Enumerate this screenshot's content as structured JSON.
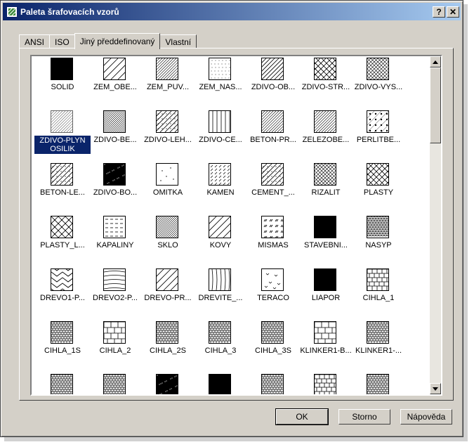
{
  "window": {
    "title": "Paleta šrafovacích vzorů",
    "help_label": "?",
    "close_label": "✕"
  },
  "tabs": [
    {
      "label": "ANSI"
    },
    {
      "label": "ISO"
    },
    {
      "label": "Jiný předdefinovaný"
    },
    {
      "label": "Vlastní"
    }
  ],
  "active_tab": "Jiný předdefinovaný",
  "patterns": [
    {
      "label": "SOLID",
      "pattern": "solid"
    },
    {
      "label": "ZEM_OBE...",
      "pattern": "diag-wide"
    },
    {
      "label": "ZEM_PUV...",
      "pattern": "diag-dense"
    },
    {
      "label": "ZEM_NAS...",
      "pattern": "dots"
    },
    {
      "label": "ZDIVO-OB...",
      "pattern": "diag-medium"
    },
    {
      "label": "ZDIVO-STR...",
      "pattern": "crosshatch"
    },
    {
      "label": "ZDIVO-VYS...",
      "pattern": "crosshatch-dense"
    },
    {
      "label": "ZDIVO-PLYN OSILIK",
      "pattern": "diag-dense",
      "selected": true
    },
    {
      "label": "ZDIVO-BE...",
      "pattern": "crosshatch-fine"
    },
    {
      "label": "ZDIVO-LEH...",
      "pattern": "diag-dots"
    },
    {
      "label": "ZDIVO-CE...",
      "pattern": "vertical"
    },
    {
      "label": "BETON-PR...",
      "pattern": "diag-dense"
    },
    {
      "label": "ZELEZOBE...",
      "pattern": "diag-dense"
    },
    {
      "label": "PERLITBE...",
      "pattern": "dots-big"
    },
    {
      "label": "BETON-LE...",
      "pattern": "diag-dots"
    },
    {
      "label": "ZDIVO-BO...",
      "pattern": "solid-speckle"
    },
    {
      "label": "OMITKA",
      "pattern": "sparse-dots"
    },
    {
      "label": "KAMEN",
      "pattern": "dashes"
    },
    {
      "label": "CEMENT_...",
      "pattern": "diag-dots"
    },
    {
      "label": "RIZALIT",
      "pattern": "crosshatch-dense"
    },
    {
      "label": "PLASTY",
      "pattern": "crosshatch"
    },
    {
      "label": "PLASTY_L...",
      "pattern": "crosshatch-dots"
    },
    {
      "label": "KAPALINY",
      "pattern": "h-dashes"
    },
    {
      "label": "SKLO",
      "pattern": "crosshatch-fine"
    },
    {
      "label": "KOVY",
      "pattern": "diag-wide"
    },
    {
      "label": "MISMAS",
      "pattern": "ticks"
    },
    {
      "label": "STAVEBNI...",
      "pattern": "solid"
    },
    {
      "label": "NASYP",
      "pattern": "gravel"
    },
    {
      "label": "DREVO1-P...",
      "pattern": "chevron"
    },
    {
      "label": "DREVO2-P...",
      "pattern": "waves"
    },
    {
      "label": "DREVO-PR...",
      "pattern": "diag-wide"
    },
    {
      "label": "DREVITE_...",
      "pattern": "vertical-wavy"
    },
    {
      "label": "TERACO",
      "pattern": "terrazzo"
    },
    {
      "label": "LIAPOR",
      "pattern": "solid"
    },
    {
      "label": "CIHLA_1",
      "pattern": "brick"
    },
    {
      "label": "CIHLA_1S",
      "pattern": "brick-dense"
    },
    {
      "label": "CIHLA_2",
      "pattern": "brick-big"
    },
    {
      "label": "CIHLA_2S",
      "pattern": "brick-dense"
    },
    {
      "label": "CIHLA_3",
      "pattern": "brick-dense"
    },
    {
      "label": "CIHLA_3S",
      "pattern": "brick-dense"
    },
    {
      "label": "KLINKER1-B...",
      "pattern": "brick-big"
    },
    {
      "label": "KLINKER1-...",
      "pattern": "brick-dense"
    },
    {
      "label": "",
      "pattern": "brick-dense"
    },
    {
      "label": "",
      "pattern": "brick-dense"
    },
    {
      "label": "",
      "pattern": "solid-speckle"
    },
    {
      "label": "",
      "pattern": "solid"
    },
    {
      "label": "",
      "pattern": "brick-dense"
    },
    {
      "label": "",
      "pattern": "brick"
    },
    {
      "label": "",
      "pattern": "brick-dense"
    }
  ],
  "scrollbar": {
    "up_icon": "scroll-up-arrow",
    "down_icon": "scroll-down-arrow",
    "position_fraction": 0.0
  },
  "buttons": {
    "ok": "OK",
    "cancel": "Storno",
    "help": "Nápověda"
  }
}
